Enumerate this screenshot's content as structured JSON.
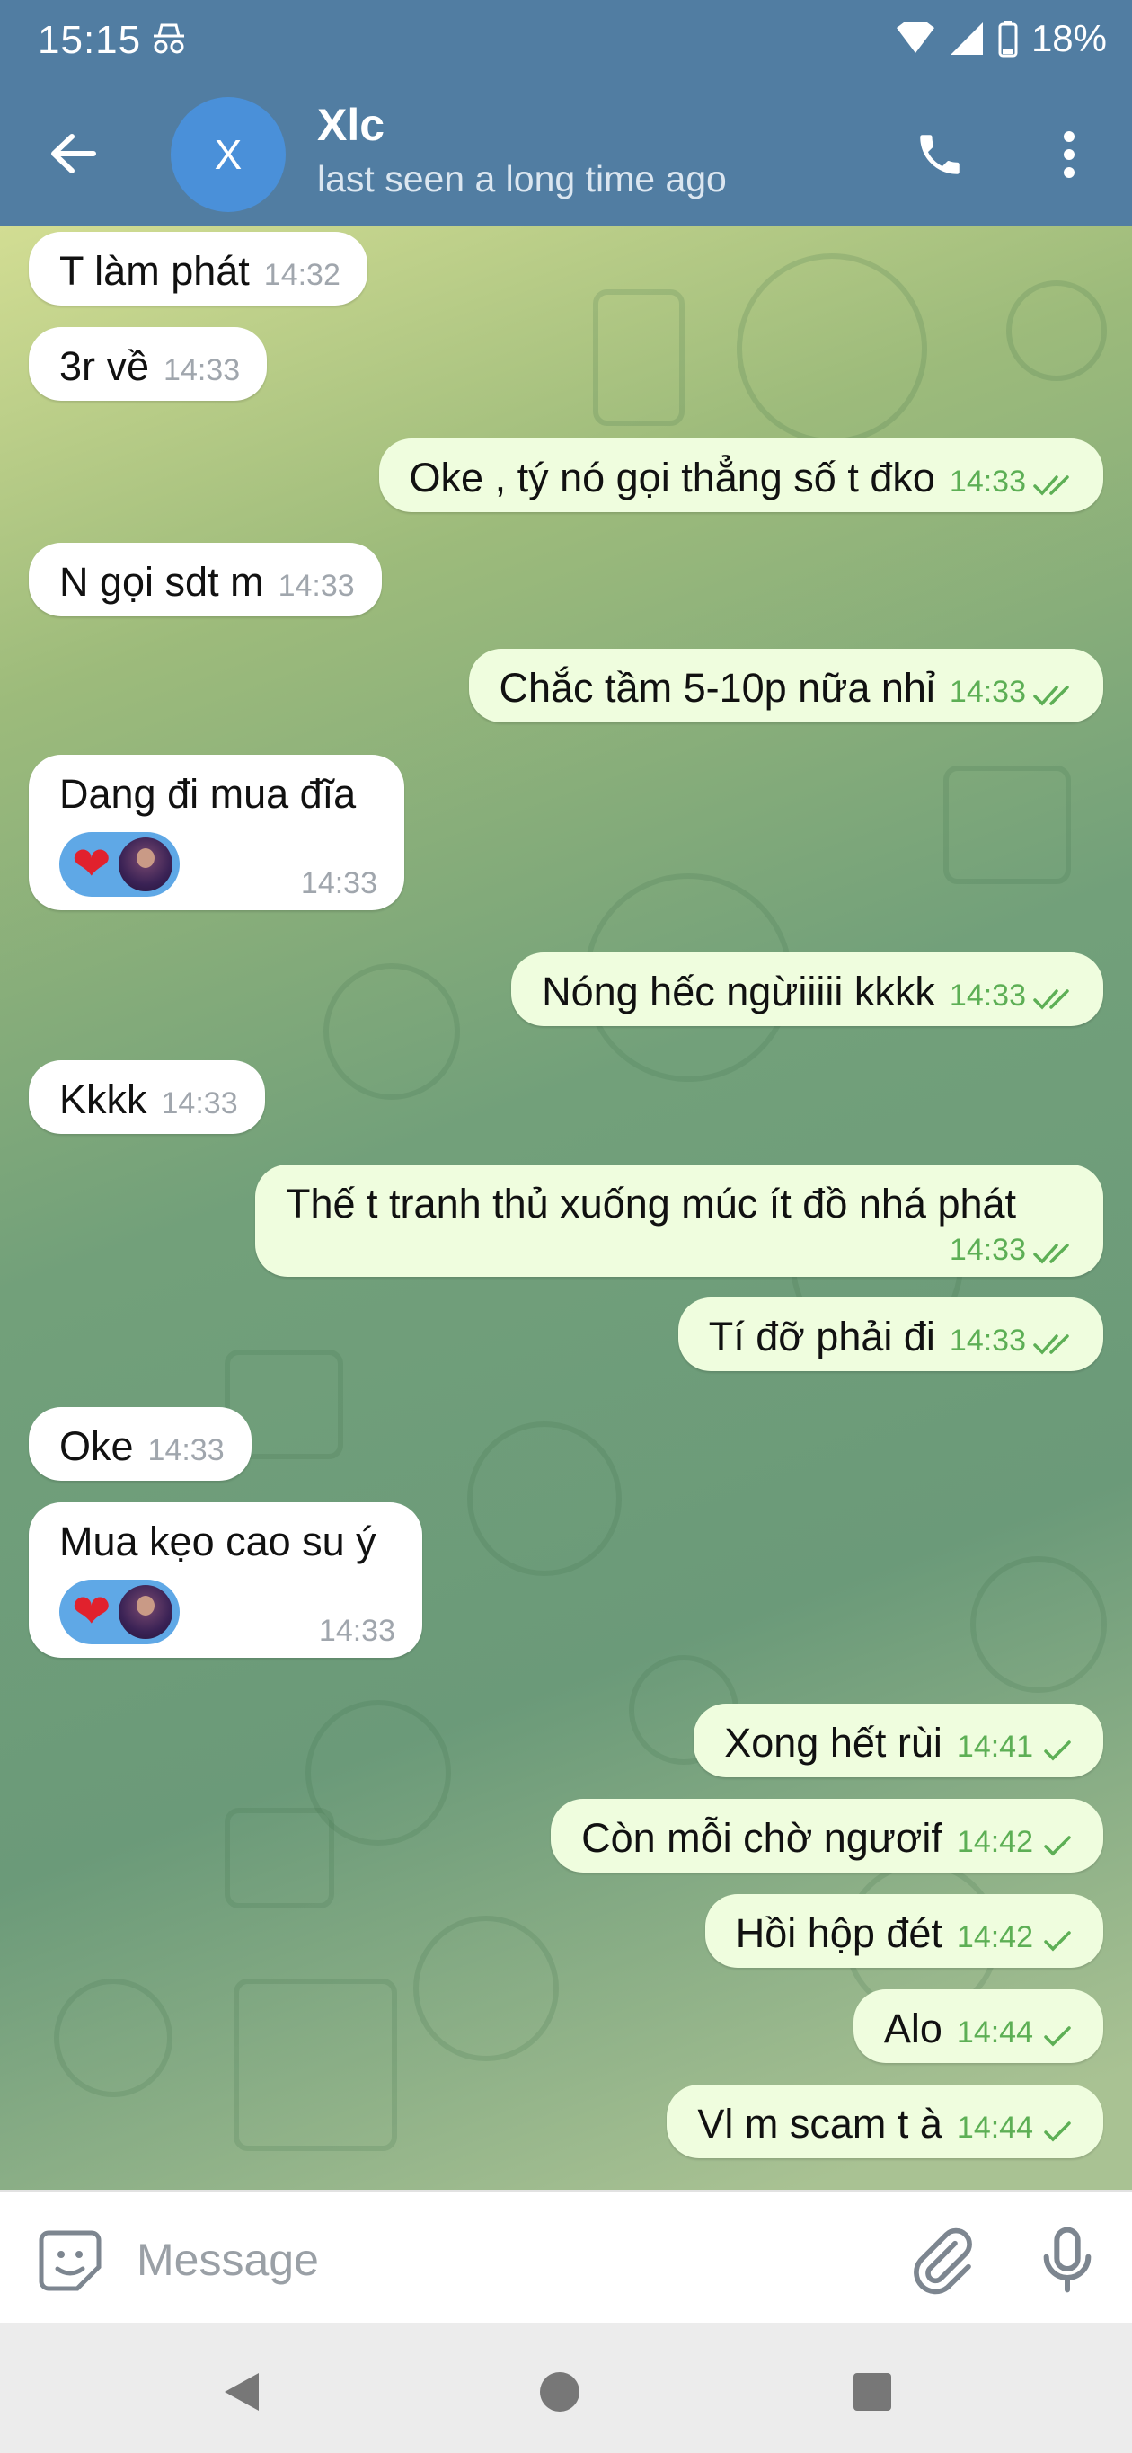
{
  "status_bar": {
    "time": "15:15",
    "battery": "18%"
  },
  "header": {
    "avatar_letter": "X",
    "name": "Xlc",
    "status": "last seen a long time ago"
  },
  "messages": [
    {
      "dir": "in",
      "text": "T làm phát",
      "time": "14:32"
    },
    {
      "dir": "in",
      "text": "3r  về",
      "time": "14:33"
    },
    {
      "dir": "out",
      "text": "Oke , tý nó gọi thẳng số t đko",
      "time": "14:33",
      "status": "read"
    },
    {
      "dir": "in",
      "text": "N gọi sdt m",
      "time": "14:33"
    },
    {
      "dir": "out",
      "text": "Chắc tầm 5-10p nữa nhỉ",
      "time": "14:33",
      "status": "read"
    },
    {
      "dir": "in",
      "text": "Dang đi mua đĩa",
      "time": "14:33",
      "reaction": "❤"
    },
    {
      "dir": "out",
      "text": "Nóng hếc ngừiiiii kkkk",
      "time": "14:33",
      "status": "read"
    },
    {
      "dir": "in",
      "text": "Kkkk",
      "time": "14:33"
    },
    {
      "dir": "out",
      "text": "Thế t tranh thủ xuống múc ít đồ nhá phát",
      "time": "14:33",
      "status": "read"
    },
    {
      "dir": "out",
      "text": "Tí đỡ phải đi",
      "time": "14:33",
      "status": "read"
    },
    {
      "dir": "in",
      "text": "Oke",
      "time": "14:33"
    },
    {
      "dir": "in",
      "text": "Mua kẹo cao su ý",
      "time": "14:33",
      "reaction": "❤"
    },
    {
      "dir": "out",
      "text": "Xong hết rùi",
      "time": "14:41",
      "status": "sent"
    },
    {
      "dir": "out",
      "text": "Còn mỗi chờ ngươif",
      "time": "14:42",
      "status": "sent"
    },
    {
      "dir": "out",
      "text": "Hồi hộp đét",
      "time": "14:42",
      "status": "sent"
    },
    {
      "dir": "out",
      "text": "Alo",
      "time": "14:44",
      "status": "sent"
    },
    {
      "dir": "out",
      "text": "Vl m scam t à",
      "time": "14:44",
      "status": "sent"
    }
  ],
  "input": {
    "placeholder": "Message"
  },
  "colors": {
    "header": "#517da2",
    "out_bubble": "#effdde",
    "in_bubble": "#ffffff",
    "check": "#5daf55",
    "reaction": "#5fa8e6"
  }
}
